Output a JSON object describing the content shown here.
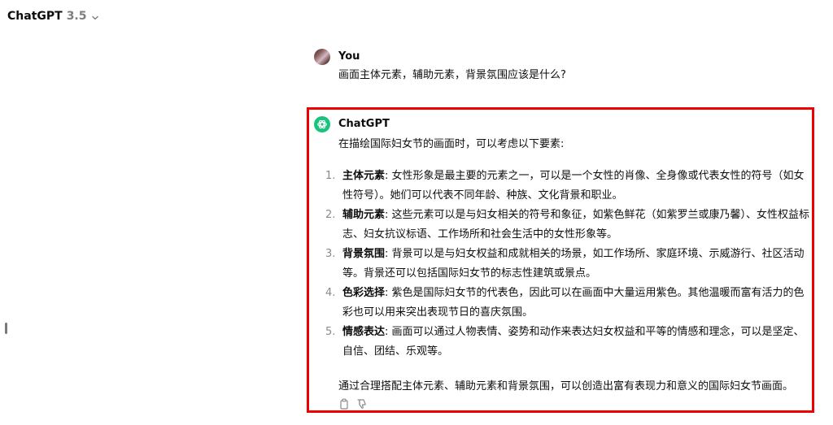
{
  "header": {
    "model_name": "ChatGPT",
    "model_version": "3.5"
  },
  "conversation": {
    "user": {
      "name": "You",
      "message": "画面主体元素，辅助元素，背景氛围应该是什么?"
    },
    "assistant": {
      "name": "ChatGPT",
      "intro": "在描绘国际妇女节的画面时，可以考虑以下要素:",
      "items": [
        {
          "number": "1.",
          "title": "主体元素",
          "text": ": 女性形象是最主要的元素之一，可以是一个女性的肖像、全身像或代表女性的符号（如女性符号）。她们可以代表不同年龄、种族、文化背景和职业。"
        },
        {
          "number": "2.",
          "title": "辅助元素",
          "text": ": 这些元素可以是与妇女相关的符号和象征，如紫色鲜花（如紫罗兰或康乃馨）、女性权益标志、妇女抗议标语、工作场所和社会生活中的女性形象等。"
        },
        {
          "number": "3.",
          "title": "背景氛围",
          "text": ": 背景可以是与妇女权益和成就相关的场景，如工作场所、家庭环境、示威游行、社区活动等。背景还可以包括国际妇女节的标志性建筑或景点。"
        },
        {
          "number": "4.",
          "title": "色彩选择",
          "text": ": 紫色是国际妇女节的代表色，因此可以在画面中大量运用紫色。其他温暖而富有活力的色彩也可以用来突出表现节日的喜庆氛围。"
        },
        {
          "number": "5.",
          "title": "情感表达",
          "text": ": 画面可以通过人物表情、姿势和动作来表达妇女权益和平等的情感和理念，可以是坚定、自信、团结、乐观等。"
        }
      ],
      "summary": "通过合理搭配主体元素、辅助元素和背景氛围，可以创造出富有表现力和意义的国际妇女节画面。",
      "actions": [
        "copy-icon",
        "thumbs-down-icon"
      ]
    }
  },
  "colors": {
    "highlight_border": "#ee0000",
    "assistant_avatar": "#19c37d"
  }
}
